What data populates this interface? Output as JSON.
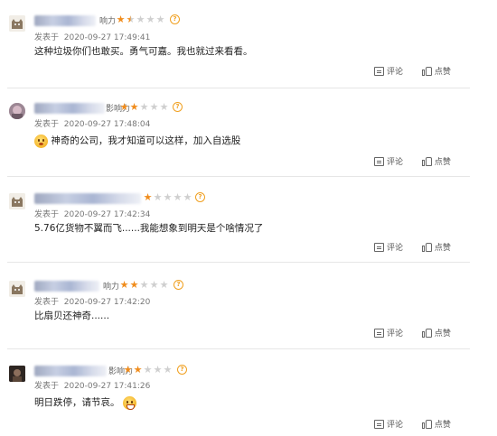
{
  "influence_label": "影响力",
  "posted_prefix": "发表于",
  "actions": {
    "comment_label": "评论",
    "like_label": "点赞"
  },
  "colors": {
    "star_filled": "#f08c1c",
    "star_empty": "#cfcfcf",
    "text": "#222222"
  },
  "comments": [
    {
      "influence_visible": "响力",
      "rating": 1.5,
      "date": "2020-09-27 17:49:41",
      "text": "这种垃圾你们也敢买。勇气可嘉。我也就过来看看。",
      "avatar": "gray-cat-avatar"
    },
    {
      "influence_visible": "影响力",
      "rating": 2,
      "date": "2020-09-27 17:48:04",
      "text": "神奇的公司，我才知道可以这样，加入自选股",
      "emoji_before": "surprised-face-emoji",
      "avatar": "photo-avatar"
    },
    {
      "influence_visible": "",
      "rating": 1,
      "date": "2020-09-27 17:42:34",
      "text": "5.76亿货物不翼而飞......我能想象到明天是个啥情况了",
      "avatar": "gray-cat-avatar"
    },
    {
      "influence_visible": "响力",
      "rating": 2,
      "date": "2020-09-27 17:42:20",
      "text": "比扇贝还神奇......",
      "avatar": "gray-cat-avatar"
    },
    {
      "influence_visible": "影响力",
      "rating": 2,
      "date": "2020-09-27 17:41:26",
      "text": "明日跌停，请节哀。",
      "emoji_after": "grinning-face-emoji",
      "avatar": "photo-avatar-dark"
    }
  ]
}
